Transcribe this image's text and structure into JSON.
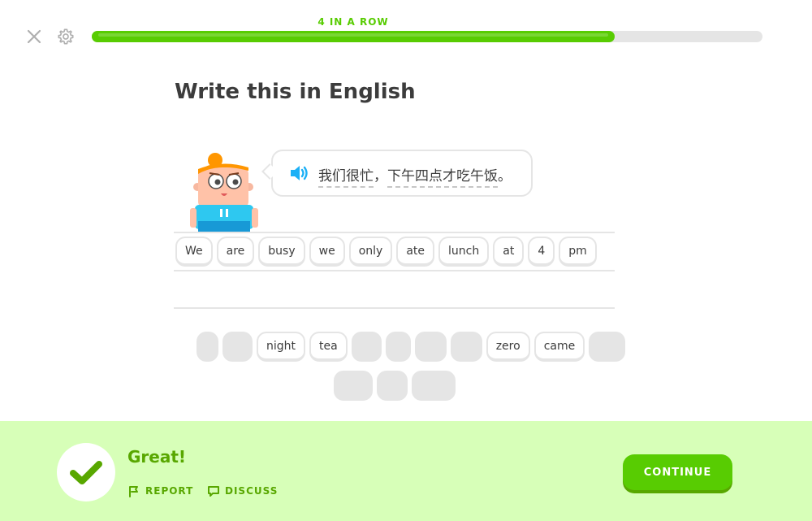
{
  "header": {
    "streak_label": "4 IN A ROW",
    "progress_fraction": 0.78
  },
  "challenge": {
    "title": "Write this in English",
    "prompt_segments": [
      "我们很忙",
      "，",
      "下午四点才吃午饭",
      "。"
    ]
  },
  "answer": {
    "words": [
      "We",
      "are",
      "busy",
      "we",
      "only",
      "ate",
      "lunch",
      "at",
      "4",
      "pm"
    ]
  },
  "word_bank": {
    "row1": [
      {
        "label": "",
        "used": true
      },
      {
        "label": "",
        "used": true
      },
      {
        "label": "night",
        "used": false
      },
      {
        "label": "tea",
        "used": false
      },
      {
        "label": "",
        "used": true
      },
      {
        "label": "",
        "used": true
      },
      {
        "label": "",
        "used": true
      },
      {
        "label": "",
        "used": true
      },
      {
        "label": "zero",
        "used": false
      },
      {
        "label": "came",
        "used": false
      },
      {
        "label": "",
        "used": true
      }
    ],
    "row2": [
      {
        "label": "",
        "used": true
      },
      {
        "label": "",
        "used": true
      },
      {
        "label": "",
        "used": true
      }
    ]
  },
  "feedback": {
    "message": "Great!",
    "report_label": "REPORT",
    "discuss_label": "DISCUSS",
    "continue_label": "CONTINUE"
  },
  "icons": {
    "close": "close-icon",
    "settings": "gear-icon",
    "speaker": "speaker-icon",
    "check": "check-icon",
    "report": "flag-icon",
    "discuss": "chat-bubble-icon"
  },
  "colors": {
    "accent": "#58cc02",
    "accent_dark": "#58a700",
    "footer_bg": "#d7ffb8",
    "track": "#e5e5e5"
  }
}
